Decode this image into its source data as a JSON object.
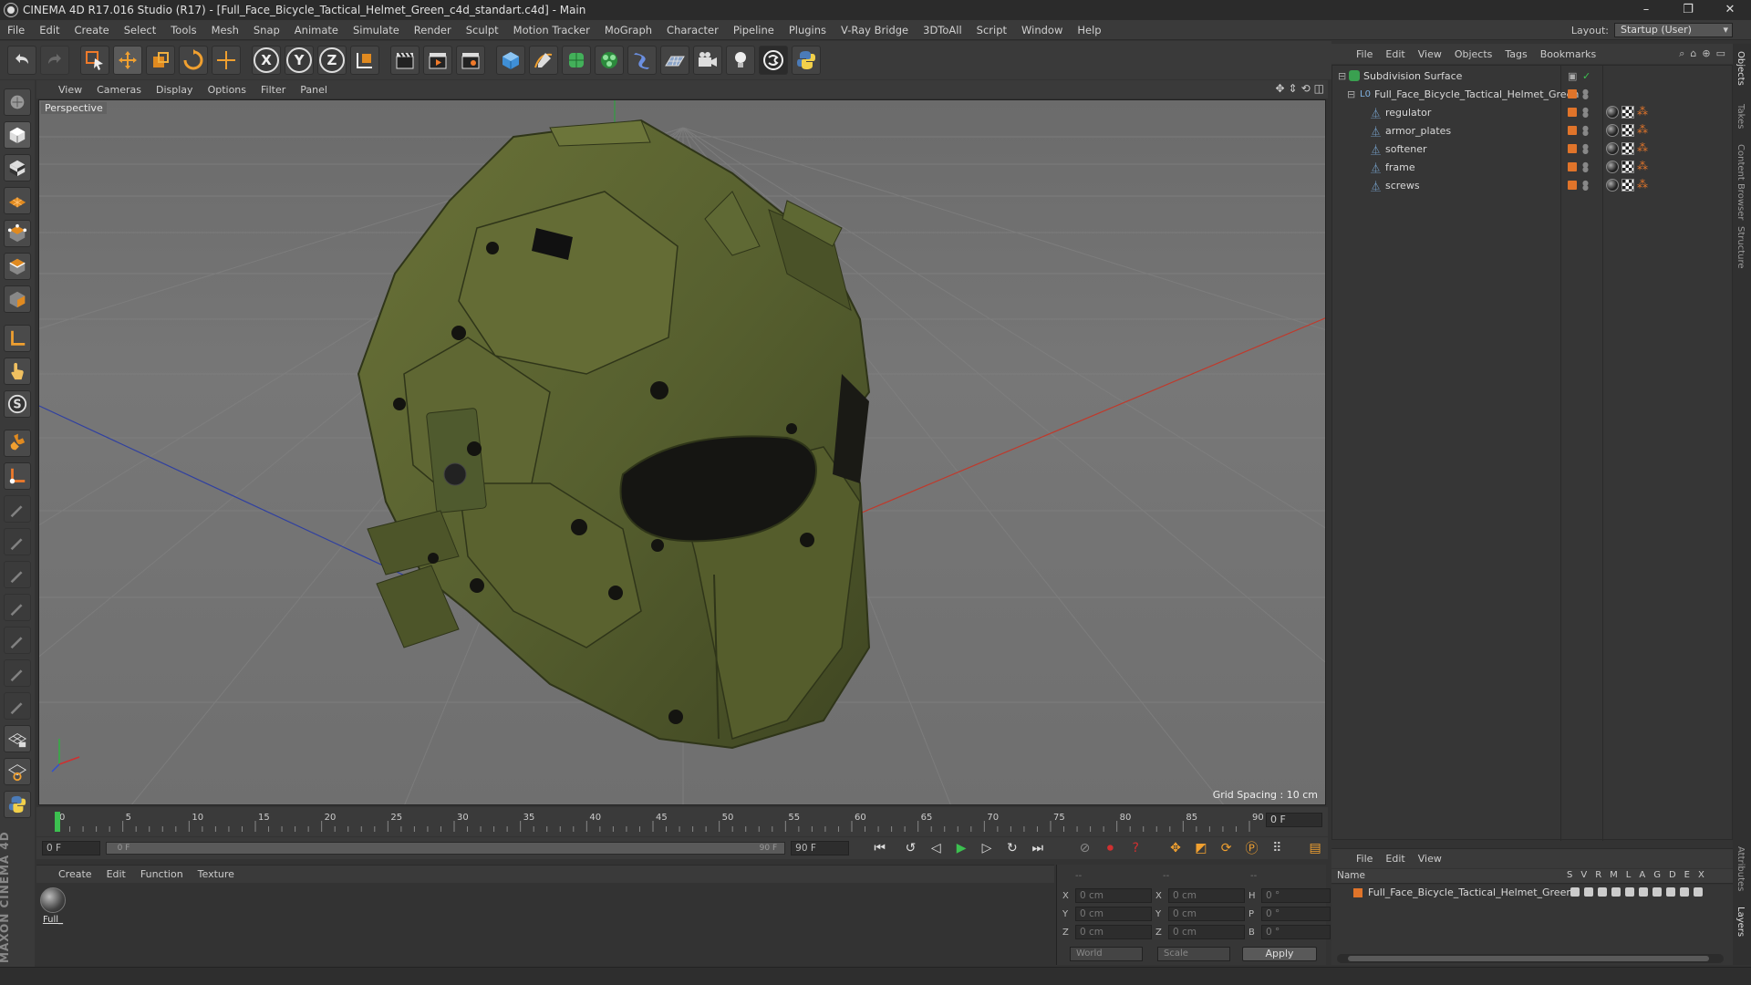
{
  "window": {
    "title": "CINEMA 4D R17.016 Studio (R17) - [Full_Face_Bicycle_Tactical_Helmet_Green_c4d_standart.c4d] - Main",
    "minimize": "–",
    "restore": "❐",
    "close": "✕"
  },
  "menu": [
    "File",
    "Edit",
    "Create",
    "Select",
    "Tools",
    "Mesh",
    "Snap",
    "Animate",
    "Simulate",
    "Render",
    "Sculpt",
    "Motion Tracker",
    "MoGraph",
    "Character",
    "Pipeline",
    "Plugins",
    "V-Ray Bridge",
    "3DToAll",
    "Script",
    "Window",
    "Help"
  ],
  "layout": {
    "label": "Layout:",
    "value": "Startup (User)"
  },
  "toolbar": {
    "axes": [
      "X",
      "Y",
      "Z"
    ]
  },
  "viewport": {
    "menu": [
      "View",
      "Cameras",
      "Display",
      "Options",
      "Filter",
      "Panel"
    ],
    "label": "Perspective",
    "grid_spacing": "Grid Spacing : 10 cm"
  },
  "timeline": {
    "ticks": [
      "0",
      "5",
      "10",
      "15",
      "20",
      "25",
      "30",
      "35",
      "40",
      "45",
      "50",
      "55",
      "60",
      "65",
      "70",
      "75",
      "80",
      "85",
      "90"
    ],
    "current_frame": "0 F",
    "start_frame": "0 F",
    "scrub_start": "0 F",
    "scrub_end": "90 F",
    "end_frame": "90 F"
  },
  "material_manager": {
    "menu": [
      "Create",
      "Edit",
      "Function",
      "Texture"
    ],
    "materials": [
      {
        "name": "Full_"
      }
    ]
  },
  "coordinates": {
    "header_cols": [
      "--",
      "--",
      "--"
    ],
    "rows": [
      {
        "a1": "X",
        "v1": "0 cm",
        "a2": "X",
        "v2": "0 cm",
        "a3": "H",
        "v3": "0 °"
      },
      {
        "a1": "Y",
        "v1": "0 cm",
        "a2": "Y",
        "v2": "0 cm",
        "a3": "P",
        "v3": "0 °"
      },
      {
        "a1": "Z",
        "v1": "0 cm",
        "a2": "Z",
        "v2": "0 cm",
        "a3": "B",
        "v3": "0 °"
      }
    ],
    "space": "World",
    "mode": "Scale",
    "apply": "Apply"
  },
  "object_manager": {
    "menu": [
      "File",
      "Edit",
      "View",
      "Objects",
      "Tags",
      "Bookmarks"
    ],
    "objects": [
      {
        "name": "Subdivision Surface",
        "level": 0
      },
      {
        "name": "Full_Face_Bicycle_Tactical_Helmet_Green",
        "level": 1
      },
      {
        "name": "regulator",
        "level": 2
      },
      {
        "name": "armor_plates",
        "level": 2
      },
      {
        "name": "softener",
        "level": 2
      },
      {
        "name": "frame",
        "level": 2
      },
      {
        "name": "screws",
        "level": 2
      }
    ]
  },
  "layer_manager": {
    "menu": [
      "File",
      "Edit",
      "View"
    ],
    "columns": [
      "Name",
      "S",
      "V",
      "R",
      "M",
      "L",
      "A",
      "G",
      "D",
      "E",
      "X"
    ],
    "layers": [
      {
        "name": "Full_Face_Bicycle_Tactical_Helmet_Green"
      }
    ]
  },
  "side_tabs": [
    "Objects",
    "Takes",
    "Content Browser",
    "Structure"
  ],
  "side_tabs_bottom": [
    "Attributes",
    "Layers"
  ],
  "brand": "MAXON CINEMA 4D",
  "colors": {
    "accent_orange": "#e0742a",
    "helmet_green": "#57602f",
    "viewport_bg": "#727272"
  }
}
